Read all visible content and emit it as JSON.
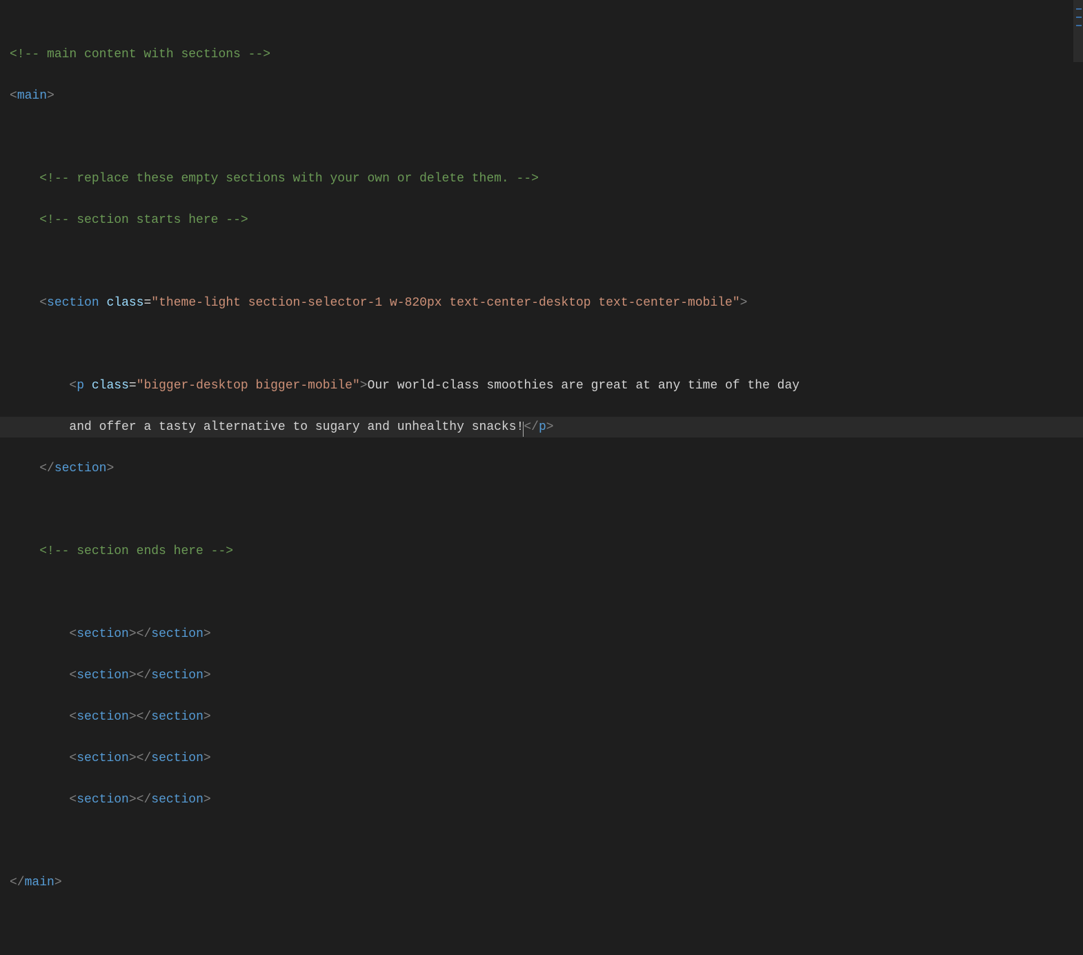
{
  "code": {
    "comment_main": "<!-- main content with sections -->",
    "main_open": {
      "lt": "<",
      "tag": "main",
      "gt": ">"
    },
    "comment_replace": "<!-- replace these empty sections with your own or delete them. -->",
    "comment_section_start": "<!-- section starts here -->",
    "section_open": {
      "lt": "<",
      "tag": "section",
      "sp": " ",
      "attr": "class",
      "eq": "=",
      "q1": "\"",
      "value": "theme-light section-selector-1 w-820px text-center-desktop text-center-mobile",
      "q2": "\"",
      "gt": ">"
    },
    "p_open": {
      "lt": "<",
      "tag": "p",
      "sp": " ",
      "attr": "class",
      "eq": "=",
      "q1": "\"",
      "value": "bigger-desktop bigger-mobile",
      "q2": "\"",
      "gt": ">"
    },
    "p_text_line1": "Our world-class smoothies are great at any time of the day",
    "p_text_line2": "and offer a tasty alternative to sugary and unhealthy snacks!",
    "p_close": {
      "lt": "</",
      "tag": "p",
      "gt": ">"
    },
    "section_close": {
      "lt": "</",
      "tag": "section",
      "gt": ">"
    },
    "comment_section_end": "<!-- section ends here -->",
    "empty_section": {
      "open_lt": "<",
      "open_tag": "section",
      "open_gt": ">",
      "close_lt": "</",
      "close_tag": "section",
      "close_gt": ">"
    },
    "main_close": {
      "lt": "</",
      "tag": "main",
      "gt": ">"
    },
    "indent1": "    ",
    "indent2": "        "
  }
}
